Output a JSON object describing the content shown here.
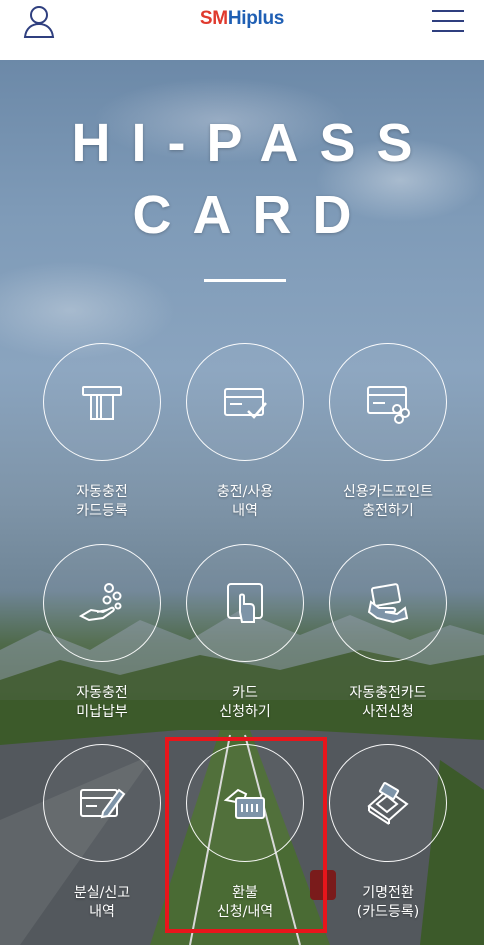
{
  "header": {
    "logo_sm": "SM",
    "logo_hi": "Hiplus",
    "user_icon": "user-icon",
    "menu_icon": "hamburger-menu-icon"
  },
  "hero": {
    "title_line1": "HI-PASS",
    "title_line2": "CARD"
  },
  "menu_items": [
    {
      "icon": "atm-card-slot-icon",
      "line1": "자동충전",
      "line2": "카드등록"
    },
    {
      "icon": "card-check-icon",
      "line1": "충전/사용",
      "line2": "내역"
    },
    {
      "icon": "card-coins-icon",
      "line1": "신용카드포인트",
      "line2": "충전하기"
    },
    {
      "icon": "hand-coins-icon",
      "line1": "자동충전",
      "line2": "미납납부"
    },
    {
      "icon": "card-tap-icon",
      "line1": "카드",
      "line2": "신청하기"
    },
    {
      "icon": "hand-card-icon",
      "line1": "자동충전카드",
      "line2": "사전신청"
    },
    {
      "icon": "card-edit-icon",
      "line1": "분실/신고",
      "line2": "내역"
    },
    {
      "icon": "card-refund-icon",
      "line1": "환불",
      "line2": "신청/내역"
    },
    {
      "icon": "card-terminal-icon",
      "line1": "기명전환",
      "line2": "(카드등록)"
    }
  ],
  "colors": {
    "logo_sm": "#e03a2e",
    "logo_hi": "#1f5fb4",
    "highlight_border": "#e8151b",
    "icon_stroke": "#ffffff"
  }
}
